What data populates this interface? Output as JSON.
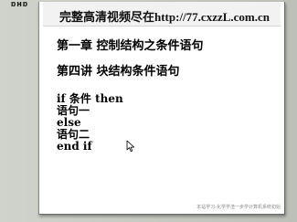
{
  "background": {
    "desktop_text": "ɒʜɒ"
  },
  "window": {
    "promo_text": "完整高清视频尽在http://77.cxzzL.com.cn",
    "chapter_title": "第一章 控制结构之条件语句",
    "lesson_title": "第四讲 块结构条件语句",
    "code_lines": [
      "if 条件 then",
      "语句一",
      "else",
      "语句二",
      "end if"
    ],
    "footer_text": "本站学习-化学学渣一步学计算机系统初始"
  },
  "icons": {
    "cursor": "mouse-pointer-icon"
  },
  "colors": {
    "desktop_bg": "#c8ccc4",
    "window_bg": "#ffffff",
    "text": "#000000"
  }
}
